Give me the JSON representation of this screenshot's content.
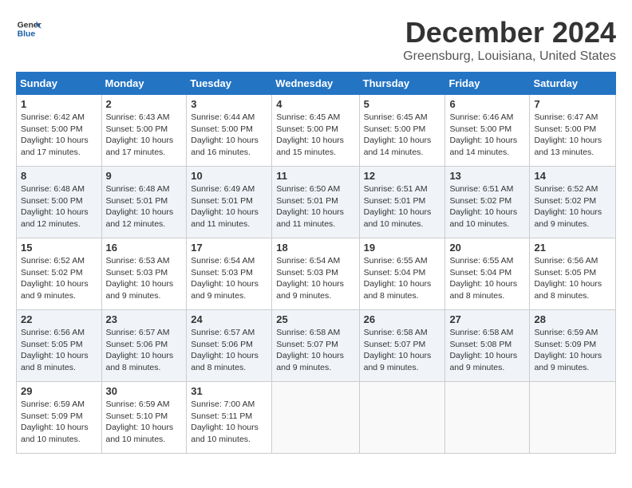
{
  "header": {
    "logo_line1": "General",
    "logo_line2": "Blue",
    "month_title": "December 2024",
    "location": "Greensburg, Louisiana, United States"
  },
  "calendar": {
    "days_of_week": [
      "Sunday",
      "Monday",
      "Tuesday",
      "Wednesday",
      "Thursday",
      "Friday",
      "Saturday"
    ],
    "weeks": [
      [
        {
          "day": "",
          "info": ""
        },
        {
          "day": "2",
          "info": "Sunrise: 6:43 AM\nSunset: 5:00 PM\nDaylight: 10 hours and 17 minutes."
        },
        {
          "day": "3",
          "info": "Sunrise: 6:44 AM\nSunset: 5:00 PM\nDaylight: 10 hours and 16 minutes."
        },
        {
          "day": "4",
          "info": "Sunrise: 6:45 AM\nSunset: 5:00 PM\nDaylight: 10 hours and 15 minutes."
        },
        {
          "day": "5",
          "info": "Sunrise: 6:45 AM\nSunset: 5:00 PM\nDaylight: 10 hours and 14 minutes."
        },
        {
          "day": "6",
          "info": "Sunrise: 6:46 AM\nSunset: 5:00 PM\nDaylight: 10 hours and 14 minutes."
        },
        {
          "day": "7",
          "info": "Sunrise: 6:47 AM\nSunset: 5:00 PM\nDaylight: 10 hours and 13 minutes."
        }
      ],
      [
        {
          "day": "1",
          "info": "Sunrise: 6:42 AM\nSunset: 5:00 PM\nDaylight: 10 hours and 17 minutes."
        },
        {
          "day": "9",
          "info": "Sunrise: 6:48 AM\nSunset: 5:01 PM\nDaylight: 10 hours and 12 minutes."
        },
        {
          "day": "10",
          "info": "Sunrise: 6:49 AM\nSunset: 5:01 PM\nDaylight: 10 hours and 11 minutes."
        },
        {
          "day": "11",
          "info": "Sunrise: 6:50 AM\nSunset: 5:01 PM\nDaylight: 10 hours and 11 minutes."
        },
        {
          "day": "12",
          "info": "Sunrise: 6:51 AM\nSunset: 5:01 PM\nDaylight: 10 hours and 10 minutes."
        },
        {
          "day": "13",
          "info": "Sunrise: 6:51 AM\nSunset: 5:02 PM\nDaylight: 10 hours and 10 minutes."
        },
        {
          "day": "14",
          "info": "Sunrise: 6:52 AM\nSunset: 5:02 PM\nDaylight: 10 hours and 9 minutes."
        }
      ],
      [
        {
          "day": "8",
          "info": "Sunrise: 6:48 AM\nSunset: 5:00 PM\nDaylight: 10 hours and 12 minutes."
        },
        {
          "day": "16",
          "info": "Sunrise: 6:53 AM\nSunset: 5:03 PM\nDaylight: 10 hours and 9 minutes."
        },
        {
          "day": "17",
          "info": "Sunrise: 6:54 AM\nSunset: 5:03 PM\nDaylight: 10 hours and 9 minutes."
        },
        {
          "day": "18",
          "info": "Sunrise: 6:54 AM\nSunset: 5:03 PM\nDaylight: 10 hours and 9 minutes."
        },
        {
          "day": "19",
          "info": "Sunrise: 6:55 AM\nSunset: 5:04 PM\nDaylight: 10 hours and 8 minutes."
        },
        {
          "day": "20",
          "info": "Sunrise: 6:55 AM\nSunset: 5:04 PM\nDaylight: 10 hours and 8 minutes."
        },
        {
          "day": "21",
          "info": "Sunrise: 6:56 AM\nSunset: 5:05 PM\nDaylight: 10 hours and 8 minutes."
        }
      ],
      [
        {
          "day": "15",
          "info": "Sunrise: 6:52 AM\nSunset: 5:02 PM\nDaylight: 10 hours and 9 minutes."
        },
        {
          "day": "23",
          "info": "Sunrise: 6:57 AM\nSunset: 5:06 PM\nDaylight: 10 hours and 8 minutes."
        },
        {
          "day": "24",
          "info": "Sunrise: 6:57 AM\nSunset: 5:06 PM\nDaylight: 10 hours and 8 minutes."
        },
        {
          "day": "25",
          "info": "Sunrise: 6:58 AM\nSunset: 5:07 PM\nDaylight: 10 hours and 9 minutes."
        },
        {
          "day": "26",
          "info": "Sunrise: 6:58 AM\nSunset: 5:07 PM\nDaylight: 10 hours and 9 minutes."
        },
        {
          "day": "27",
          "info": "Sunrise: 6:58 AM\nSunset: 5:08 PM\nDaylight: 10 hours and 9 minutes."
        },
        {
          "day": "28",
          "info": "Sunrise: 6:59 AM\nSunset: 5:09 PM\nDaylight: 10 hours and 9 minutes."
        }
      ],
      [
        {
          "day": "22",
          "info": "Sunrise: 6:56 AM\nSunset: 5:05 PM\nDaylight: 10 hours and 8 minutes."
        },
        {
          "day": "30",
          "info": "Sunrise: 6:59 AM\nSunset: 5:10 PM\nDaylight: 10 hours and 10 minutes."
        },
        {
          "day": "31",
          "info": "Sunrise: 7:00 AM\nSunset: 5:11 PM\nDaylight: 10 hours and 10 minutes."
        },
        {
          "day": "",
          "info": ""
        },
        {
          "day": "",
          "info": ""
        },
        {
          "day": "",
          "info": ""
        },
        {
          "day": "",
          "info": ""
        }
      ],
      [
        {
          "day": "29",
          "info": "Sunrise: 6:59 AM\nSunset: 5:09 PM\nDaylight: 10 hours and 10 minutes."
        },
        {
          "day": "",
          "info": ""
        },
        {
          "day": "",
          "info": ""
        },
        {
          "day": "",
          "info": ""
        },
        {
          "day": "",
          "info": ""
        },
        {
          "day": "",
          "info": ""
        },
        {
          "day": "",
          "info": ""
        }
      ]
    ]
  }
}
